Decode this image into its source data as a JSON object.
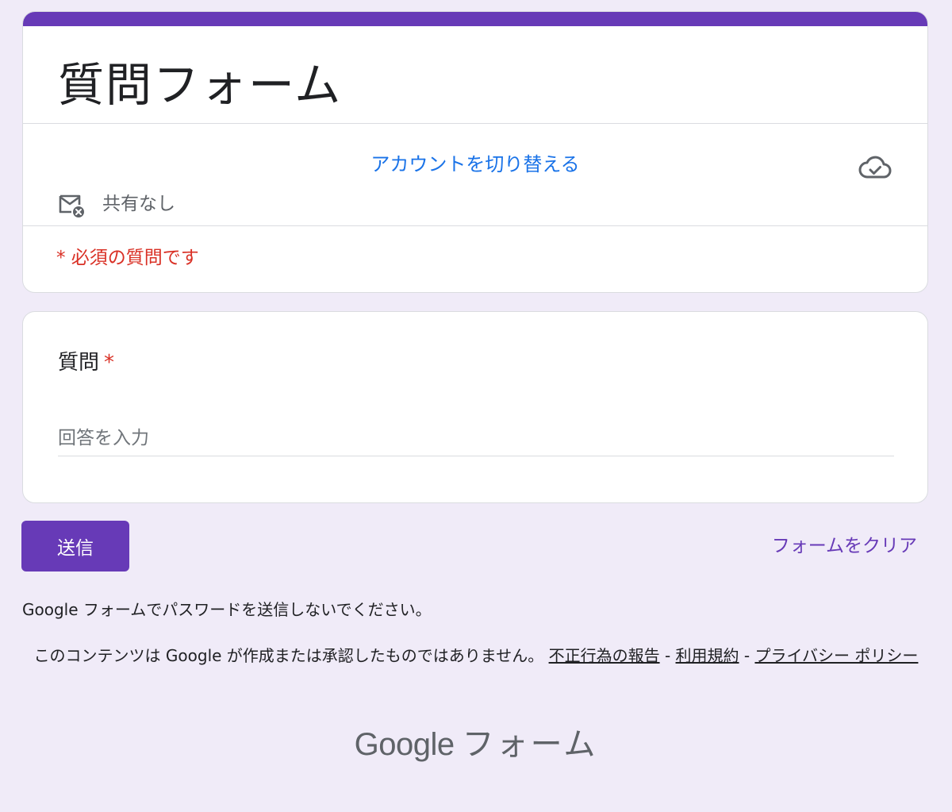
{
  "header": {
    "title": "質問フォーム",
    "switch_account": "アカウントを切り替える",
    "share_status": "共有なし",
    "required_note": "* 必須の質問です",
    "accent_color": "#673ab7",
    "cloud_icon": "cloud-check-icon",
    "mail_icon": "mail-not-shared-icon"
  },
  "question": {
    "label": "質問",
    "required_mark": "*",
    "answer_placeholder": "回答を入力",
    "answer_value": ""
  },
  "actions": {
    "submit_label": "送信",
    "clear_label": "フォームをクリア"
  },
  "footer": {
    "password_warning": "Google フォームでパスワードを送信しないでください。",
    "disclaimer": "このコンテンツは Google が作成または承認したものではありません。",
    "report_link": "不正行為の報告",
    "terms_link": "利用規約",
    "privacy_link": "プライバシー ポリシー",
    "separator": "-",
    "brand_google": "Google",
    "brand_product": "フォーム"
  }
}
